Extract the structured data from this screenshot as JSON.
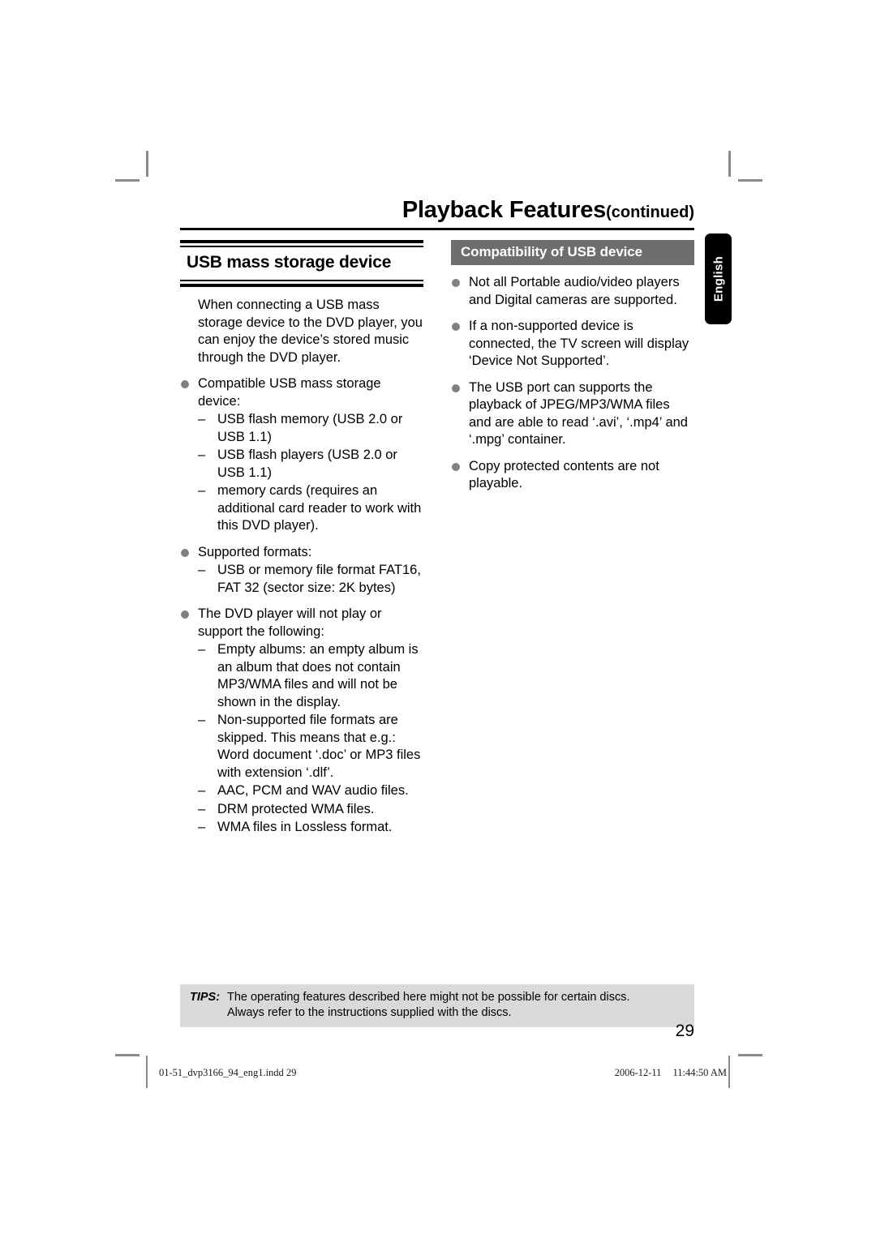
{
  "header": {
    "title_main": "Playback Features",
    "title_continued": "(continued)"
  },
  "language_tab": {
    "label": "English"
  },
  "left_column": {
    "section_title_lead": "USB",
    "section_title_rest": " mass storage device",
    "intro_paragraph": "When connecting a USB mass storage device to the DVD player, you can enjoy the device’s stored music through the DVD player.",
    "bullets": [
      {
        "text": "Compatible USB mass storage device:",
        "subitems": [
          "USB flash memory (USB 2.0 or USB 1.1)",
          "USB flash players (USB 2.0 or USB 1.1)",
          "memory cards (requires an additional card reader to work with this DVD player)."
        ]
      },
      {
        "text": "Supported formats:",
        "subitems": [
          "USB or memory file format FAT16, FAT 32 (sector size: 2K bytes)"
        ]
      },
      {
        "text": "The DVD player will not play or support the following:",
        "subitems": [
          "Empty albums: an empty album is an album that does not contain MP3/WMA files and will not be shown in the display.",
          "Non-supported file formats are skipped. This means that e.g.: Word document ‘.doc’ or MP3 files with extension ‘.dlf’.",
          "AAC, PCM and WAV audio files.",
          "DRM protected WMA files.",
          "WMA files in Lossless format."
        ]
      }
    ]
  },
  "right_column": {
    "bar_heading": "Compatibility of USB device",
    "bullets": [
      "Not all Portable audio/video players and Digital cameras are supported.",
      "If a non-supported device is connected, the TV screen will display ‘Device Not Supported’.",
      "The USB port can supports the playback of JPEG/MP3/WMA files and are able to read ‘.avi’, ‘.mp4’ and ‘.mpg’ container.",
      "Copy protected contents are not playable."
    ]
  },
  "tips": {
    "label": "TIPS:",
    "line1": "The operating features described here might not be possible for certain discs.",
    "line2": "Always refer to the instructions supplied with the discs."
  },
  "page_number": "29",
  "print_footer": {
    "filename": "01-51_dvp3166_94_eng1.indd   29",
    "date": "2006-12-11",
    "time": "11:44:50 AM"
  },
  "colors": {
    "bar_gray": "#6e6e6e",
    "bullet_gray": "#808080",
    "tips_gray": "#d9d9d9",
    "tab_black": "#000000",
    "cropmark_gray": "#8a8a8a"
  }
}
